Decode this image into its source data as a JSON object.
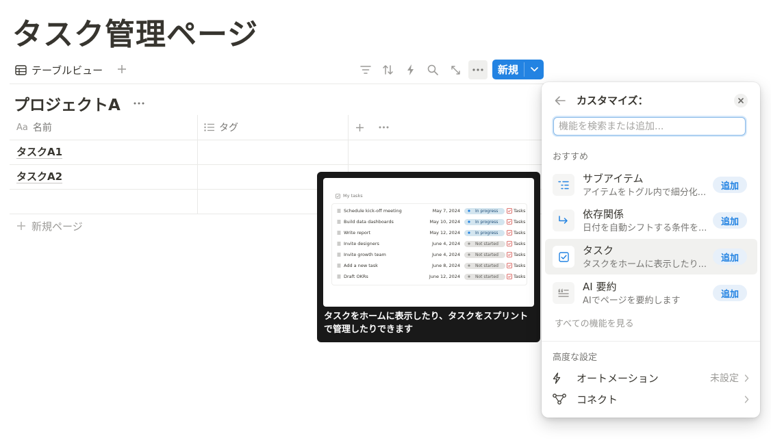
{
  "page": {
    "title": "タスク管理ページ"
  },
  "view": {
    "tab_label": "テーブルビュー",
    "new_button_label": "新規"
  },
  "group": {
    "title": "プロジェクトA"
  },
  "table": {
    "columns": [
      {
        "label": "名前",
        "icon": "text-type-icon"
      },
      {
        "label": "タグ",
        "icon": "list-icon"
      }
    ],
    "rows": [
      {
        "name": "タスクA1",
        "tag": ""
      },
      {
        "name": "タスクA2",
        "tag": ""
      },
      {
        "name": "",
        "tag": ""
      }
    ],
    "new_page_label": "新規ページ"
  },
  "tooltip": {
    "caption": "タスクをホームに表示したり、タスクをスプリントで管理したりできます",
    "preview": {
      "header": "My tasks",
      "tasks_label": "Tasks",
      "rows": [
        {
          "name": "Schedule kick-off meeting",
          "date": "May 7, 2024",
          "status": "In progress"
        },
        {
          "name": "Build data dashboards",
          "date": "May 10, 2024",
          "status": "In progress"
        },
        {
          "name": "Write report",
          "date": "May 12, 2024",
          "status": "In progress"
        },
        {
          "name": "Invite designers",
          "date": "June 4, 2024",
          "status": "Not started"
        },
        {
          "name": "Invite growth team",
          "date": "June 4, 2024",
          "status": "Not started"
        },
        {
          "name": "Add a new task",
          "date": "June 8, 2024",
          "status": "Not started"
        },
        {
          "name": "Draft OKRs",
          "date": "June 12, 2024",
          "status": "Not started"
        }
      ]
    }
  },
  "customize": {
    "title": "カスタマイズ：",
    "search_placeholder": "機能を検索または追加...",
    "recommended_label": "おすすめ",
    "add_label": "追加",
    "features": [
      {
        "name": "サブアイテム",
        "desc": "アイテムをトグル内で細分化...",
        "icon": "sub-items-icon"
      },
      {
        "name": "依存関係",
        "desc": "日付を自動シフトする条件を...",
        "icon": "dependency-arrow-icon"
      },
      {
        "name": "タスク",
        "desc": "タスクをホームに表示したり...",
        "icon": "checkbox-icon"
      },
      {
        "name": "AI 要約",
        "desc": "AIでページを要約します",
        "icon": "ai-summary-icon"
      }
    ],
    "see_all_label": "すべての機能を見る",
    "advanced_label": "高度な設定",
    "advanced": [
      {
        "label": "オートメーション",
        "value": "未設定",
        "icon": "lightning-icon"
      },
      {
        "label": "コネクト",
        "value": "",
        "icon": "connect-icon"
      }
    ]
  },
  "colors": {
    "accent": "#2383e2",
    "text": "#37352f",
    "muted": "#787774",
    "in_progress": "#d3e5ef",
    "not_started": "#e3e2e0"
  }
}
